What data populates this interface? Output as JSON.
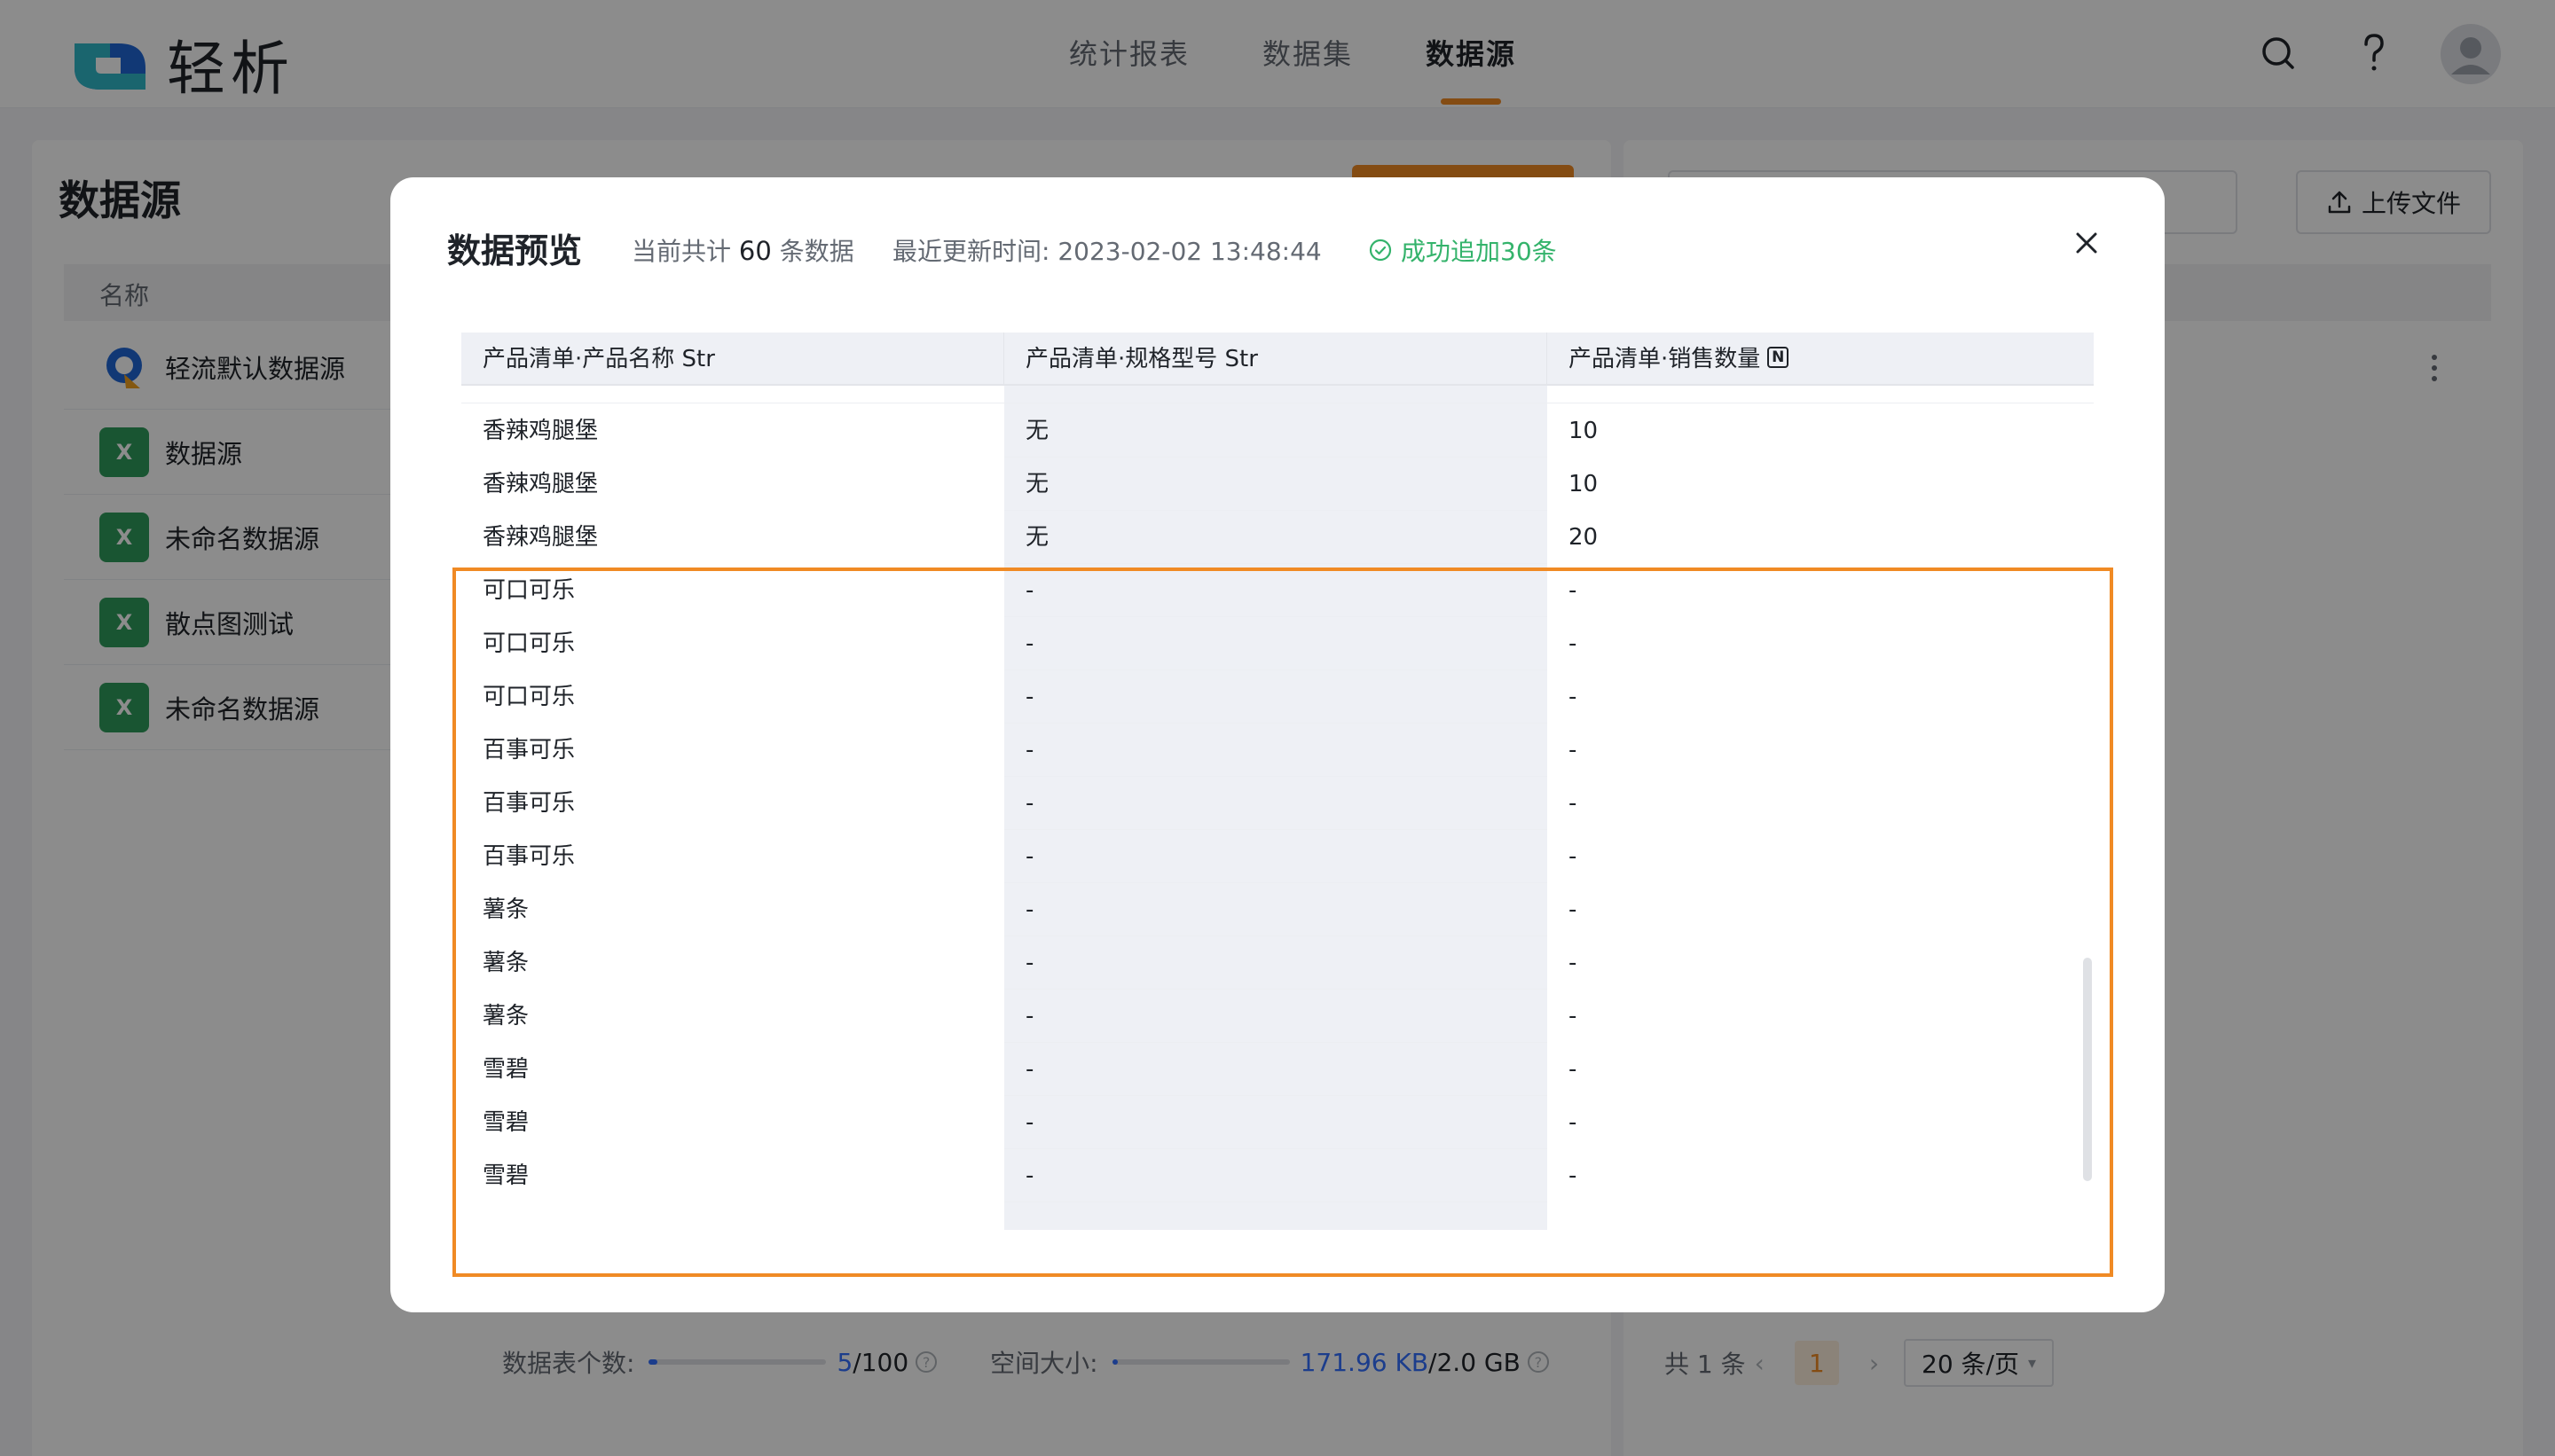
{
  "app": {
    "name": "轻析"
  },
  "nav": {
    "items": [
      "统计报表",
      "数据集",
      "数据源"
    ],
    "active": "数据源"
  },
  "page": {
    "title": "数据源",
    "column_name": "名称",
    "upload_label": "上传文件",
    "datasources": [
      {
        "name": "轻流默认数据源",
        "icon": "qingliu-logo-icon"
      },
      {
        "name": "数据源",
        "icon": "excel-icon"
      },
      {
        "name": "未命名数据源",
        "icon": "excel-icon"
      },
      {
        "name": "散点图测试",
        "icon": "excel-icon"
      },
      {
        "name": "未命名数据源",
        "icon": "excel-icon"
      }
    ],
    "footer": {
      "table_count_label": "数据表个数:",
      "table_count_used": "5",
      "table_count_total": "/100",
      "table_count_fraction": 0.05,
      "space_label": "空间大小:",
      "space_used": "171.96 KB",
      "space_total": "/2.0 GB",
      "space_fraction": 0.0001
    },
    "pager": {
      "total_text": "共 1 条",
      "current": "1",
      "size": "20 条/页"
    }
  },
  "modal": {
    "title": "数据预览",
    "count_prefix": "当前共计",
    "count": "60",
    "count_suffix": "条数据",
    "updated_label": "最近更新时间:",
    "updated_time": "2023-02-02 13:48:44",
    "success": "成功追加30条",
    "columns": [
      {
        "label": "产品清单·产品名称 Str"
      },
      {
        "label": "产品清单·规格型号 Str"
      },
      {
        "label": "产品清单·销售数量",
        "type_icon": "N"
      }
    ],
    "rows": [
      [
        "香辣鸡腿堡",
        "无",
        "10"
      ],
      [
        "香辣鸡腿堡",
        "无",
        "10"
      ],
      [
        "香辣鸡腿堡",
        "无",
        "20"
      ],
      [
        "可口可乐",
        "-",
        "-"
      ],
      [
        "可口可乐",
        "-",
        "-"
      ],
      [
        "可口可乐",
        "-",
        "-"
      ],
      [
        "百事可乐",
        "-",
        "-"
      ],
      [
        "百事可乐",
        "-",
        "-"
      ],
      [
        "百事可乐",
        "-",
        "-"
      ],
      [
        "薯条",
        "-",
        "-"
      ],
      [
        "薯条",
        "-",
        "-"
      ],
      [
        "薯条",
        "-",
        "-"
      ],
      [
        "雪碧",
        "-",
        "-"
      ],
      [
        "雪碧",
        "-",
        "-"
      ],
      [
        "雪碧",
        "-",
        "-"
      ]
    ]
  },
  "colors": {
    "accent": "#f08a24",
    "success": "#34b36b",
    "excel": "#2f9b5b",
    "link": "#3370ff"
  }
}
